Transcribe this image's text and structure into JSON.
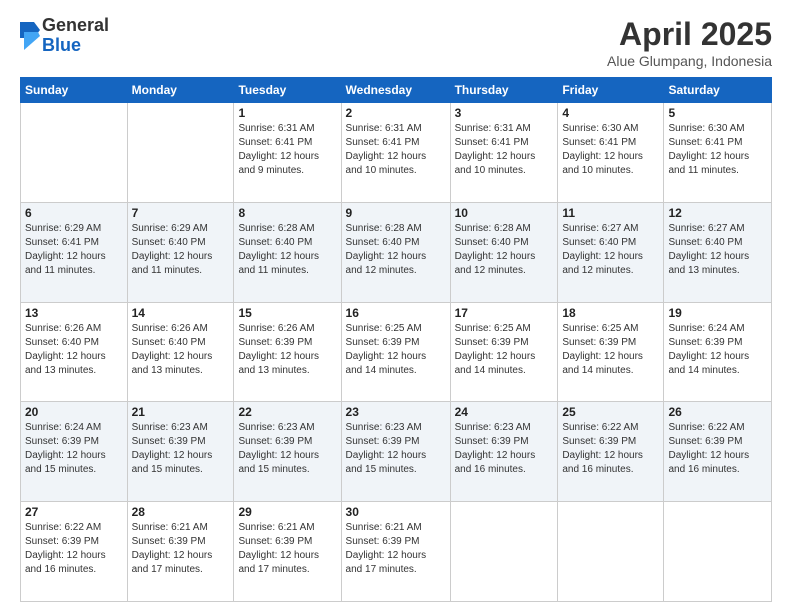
{
  "logo": {
    "general": "General",
    "blue": "Blue"
  },
  "title": {
    "month": "April 2025",
    "location": "Alue Glumpang, Indonesia"
  },
  "weekdays": [
    "Sunday",
    "Monday",
    "Tuesday",
    "Wednesday",
    "Thursday",
    "Friday",
    "Saturday"
  ],
  "weeks": [
    [
      {
        "day": "",
        "sunrise": "",
        "sunset": "",
        "daylight": ""
      },
      {
        "day": "",
        "sunrise": "",
        "sunset": "",
        "daylight": ""
      },
      {
        "day": "1",
        "sunrise": "Sunrise: 6:31 AM",
        "sunset": "Sunset: 6:41 PM",
        "daylight": "Daylight: 12 hours and 9 minutes."
      },
      {
        "day": "2",
        "sunrise": "Sunrise: 6:31 AM",
        "sunset": "Sunset: 6:41 PM",
        "daylight": "Daylight: 12 hours and 10 minutes."
      },
      {
        "day": "3",
        "sunrise": "Sunrise: 6:31 AM",
        "sunset": "Sunset: 6:41 PM",
        "daylight": "Daylight: 12 hours and 10 minutes."
      },
      {
        "day": "4",
        "sunrise": "Sunrise: 6:30 AM",
        "sunset": "Sunset: 6:41 PM",
        "daylight": "Daylight: 12 hours and 10 minutes."
      },
      {
        "day": "5",
        "sunrise": "Sunrise: 6:30 AM",
        "sunset": "Sunset: 6:41 PM",
        "daylight": "Daylight: 12 hours and 11 minutes."
      }
    ],
    [
      {
        "day": "6",
        "sunrise": "Sunrise: 6:29 AM",
        "sunset": "Sunset: 6:41 PM",
        "daylight": "Daylight: 12 hours and 11 minutes."
      },
      {
        "day": "7",
        "sunrise": "Sunrise: 6:29 AM",
        "sunset": "Sunset: 6:40 PM",
        "daylight": "Daylight: 12 hours and 11 minutes."
      },
      {
        "day": "8",
        "sunrise": "Sunrise: 6:28 AM",
        "sunset": "Sunset: 6:40 PM",
        "daylight": "Daylight: 12 hours and 11 minutes."
      },
      {
        "day": "9",
        "sunrise": "Sunrise: 6:28 AM",
        "sunset": "Sunset: 6:40 PM",
        "daylight": "Daylight: 12 hours and 12 minutes."
      },
      {
        "day": "10",
        "sunrise": "Sunrise: 6:28 AM",
        "sunset": "Sunset: 6:40 PM",
        "daylight": "Daylight: 12 hours and 12 minutes."
      },
      {
        "day": "11",
        "sunrise": "Sunrise: 6:27 AM",
        "sunset": "Sunset: 6:40 PM",
        "daylight": "Daylight: 12 hours and 12 minutes."
      },
      {
        "day": "12",
        "sunrise": "Sunrise: 6:27 AM",
        "sunset": "Sunset: 6:40 PM",
        "daylight": "Daylight: 12 hours and 13 minutes."
      }
    ],
    [
      {
        "day": "13",
        "sunrise": "Sunrise: 6:26 AM",
        "sunset": "Sunset: 6:40 PM",
        "daylight": "Daylight: 12 hours and 13 minutes."
      },
      {
        "day": "14",
        "sunrise": "Sunrise: 6:26 AM",
        "sunset": "Sunset: 6:40 PM",
        "daylight": "Daylight: 12 hours and 13 minutes."
      },
      {
        "day": "15",
        "sunrise": "Sunrise: 6:26 AM",
        "sunset": "Sunset: 6:39 PM",
        "daylight": "Daylight: 12 hours and 13 minutes."
      },
      {
        "day": "16",
        "sunrise": "Sunrise: 6:25 AM",
        "sunset": "Sunset: 6:39 PM",
        "daylight": "Daylight: 12 hours and 14 minutes."
      },
      {
        "day": "17",
        "sunrise": "Sunrise: 6:25 AM",
        "sunset": "Sunset: 6:39 PM",
        "daylight": "Daylight: 12 hours and 14 minutes."
      },
      {
        "day": "18",
        "sunrise": "Sunrise: 6:25 AM",
        "sunset": "Sunset: 6:39 PM",
        "daylight": "Daylight: 12 hours and 14 minutes."
      },
      {
        "day": "19",
        "sunrise": "Sunrise: 6:24 AM",
        "sunset": "Sunset: 6:39 PM",
        "daylight": "Daylight: 12 hours and 14 minutes."
      }
    ],
    [
      {
        "day": "20",
        "sunrise": "Sunrise: 6:24 AM",
        "sunset": "Sunset: 6:39 PM",
        "daylight": "Daylight: 12 hours and 15 minutes."
      },
      {
        "day": "21",
        "sunrise": "Sunrise: 6:23 AM",
        "sunset": "Sunset: 6:39 PM",
        "daylight": "Daylight: 12 hours and 15 minutes."
      },
      {
        "day": "22",
        "sunrise": "Sunrise: 6:23 AM",
        "sunset": "Sunset: 6:39 PM",
        "daylight": "Daylight: 12 hours and 15 minutes."
      },
      {
        "day": "23",
        "sunrise": "Sunrise: 6:23 AM",
        "sunset": "Sunset: 6:39 PM",
        "daylight": "Daylight: 12 hours and 15 minutes."
      },
      {
        "day": "24",
        "sunrise": "Sunrise: 6:23 AM",
        "sunset": "Sunset: 6:39 PM",
        "daylight": "Daylight: 12 hours and 16 minutes."
      },
      {
        "day": "25",
        "sunrise": "Sunrise: 6:22 AM",
        "sunset": "Sunset: 6:39 PM",
        "daylight": "Daylight: 12 hours and 16 minutes."
      },
      {
        "day": "26",
        "sunrise": "Sunrise: 6:22 AM",
        "sunset": "Sunset: 6:39 PM",
        "daylight": "Daylight: 12 hours and 16 minutes."
      }
    ],
    [
      {
        "day": "27",
        "sunrise": "Sunrise: 6:22 AM",
        "sunset": "Sunset: 6:39 PM",
        "daylight": "Daylight: 12 hours and 16 minutes."
      },
      {
        "day": "28",
        "sunrise": "Sunrise: 6:21 AM",
        "sunset": "Sunset: 6:39 PM",
        "daylight": "Daylight: 12 hours and 17 minutes."
      },
      {
        "day": "29",
        "sunrise": "Sunrise: 6:21 AM",
        "sunset": "Sunset: 6:39 PM",
        "daylight": "Daylight: 12 hours and 17 minutes."
      },
      {
        "day": "30",
        "sunrise": "Sunrise: 6:21 AM",
        "sunset": "Sunset: 6:39 PM",
        "daylight": "Daylight: 12 hours and 17 minutes."
      },
      {
        "day": "",
        "sunrise": "",
        "sunset": "",
        "daylight": ""
      },
      {
        "day": "",
        "sunrise": "",
        "sunset": "",
        "daylight": ""
      },
      {
        "day": "",
        "sunrise": "",
        "sunset": "",
        "daylight": ""
      }
    ]
  ]
}
